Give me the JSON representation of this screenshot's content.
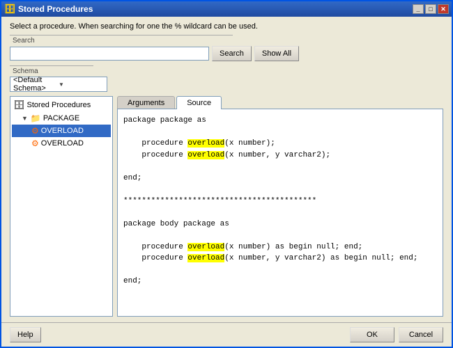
{
  "window": {
    "title": "Stored Procedures",
    "icon": "🗄"
  },
  "description": "Select a procedure. When searching for one the % wildcard can be used.",
  "search": {
    "label": "Search",
    "placeholder": "",
    "value": "",
    "search_btn": "Search",
    "show_all_btn": "Show All"
  },
  "schema": {
    "label": "Schema",
    "value": "<Default Schema>"
  },
  "tree": {
    "root_label": "Stored Procedures",
    "items": [
      {
        "label": "PACKAGE",
        "level": 1,
        "type": "folder",
        "expanded": true
      },
      {
        "label": "OVERLOAD",
        "level": 2,
        "type": "proc",
        "selected": true
      },
      {
        "label": "OVERLOAD",
        "level": 2,
        "type": "proc",
        "selected": false
      }
    ]
  },
  "tabs": [
    {
      "label": "Arguments",
      "active": false
    },
    {
      "label": "Source",
      "active": true
    }
  ],
  "source_code": [
    {
      "line": "package package as",
      "indent": 0
    },
    {
      "line": "",
      "indent": 0
    },
    {
      "line": "    procedure overload(x number);",
      "indent": 0,
      "highlight_word": "overload",
      "highlight_start": 14,
      "highlight_end": 21
    },
    {
      "line": "    procedure overload(x number, y varchar2);",
      "indent": 0,
      "highlight_word": "overload",
      "highlight_start": 14,
      "highlight_end": 21
    },
    {
      "line": "",
      "indent": 0
    },
    {
      "line": "end;",
      "indent": 0
    },
    {
      "line": "",
      "indent": 0
    },
    {
      "line": "******************************************",
      "indent": 0
    },
    {
      "line": "",
      "indent": 0
    },
    {
      "line": "package body package as",
      "indent": 0
    },
    {
      "line": "",
      "indent": 0
    },
    {
      "line": "    procedure overload(x number) as begin null; end;",
      "indent": 0,
      "highlight_word": "overload",
      "highlight_start": 14,
      "highlight_end": 21
    },
    {
      "line": "    procedure overload(x number, y varchar2) as begin null; end;",
      "indent": 0,
      "highlight_word": "overload",
      "highlight_start": 14,
      "highlight_end": 21
    },
    {
      "line": "",
      "indent": 0
    },
    {
      "line": "end;",
      "indent": 0
    }
  ],
  "footer": {
    "help_btn": "Help",
    "ok_btn": "OK",
    "cancel_btn": "Cancel"
  },
  "colors": {
    "accent": "#316ac5",
    "highlight": "#ffff00"
  }
}
